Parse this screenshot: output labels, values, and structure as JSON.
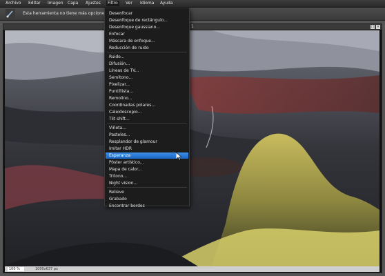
{
  "menubar": {
    "items": [
      "Archivo",
      "Editar",
      "Imagen",
      "Capa",
      "Ajustes",
      "Filtro",
      "Ver",
      "Idioma",
      "Ayuda"
    ],
    "active": "Filtro"
  },
  "toolbar": {
    "icon": "brush-tool-icon",
    "message": "Esta herramienta no tiene más opciones"
  },
  "image_window": {
    "title_number": "1",
    "zoom": "100 %",
    "dimensions": "1000x637 px"
  },
  "filter_menu": {
    "items": [
      "Desenfocar",
      "Desenfoque de rectángulo...",
      "Desenfoque gaussiano...",
      "Enfocar",
      "Máscara de enfoque...",
      "Reducción de ruido",
      "Ruido...",
      "Difusión...",
      "Líneas de TV...",
      "Semitono...",
      "Pixelizar...",
      "Puntillista...",
      "Remolino...",
      "Coordinadas polares...",
      "Caleidoscopio...",
      "Tilt shift...",
      "Viñeta...",
      "Pasteles...",
      "Resplandor de glamour",
      "Imitar HDR",
      "Esperanza",
      "Póster artístico...",
      "Mapa de calor...",
      "Tritono...",
      "Night vision...",
      "Relieve",
      "Grabado",
      "Encontrar bordes"
    ],
    "highlighted": "Esperanza"
  },
  "colors": {
    "menu_highlight": "#2a7ad8",
    "menubar_bg": "#2e2e2e",
    "dropdown_bg": "#1c1c1c"
  }
}
